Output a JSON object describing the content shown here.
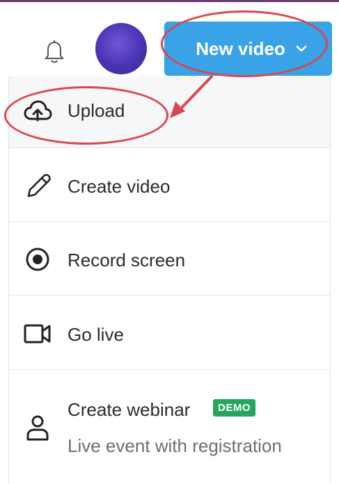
{
  "header": {
    "new_video_label": "New video"
  },
  "menu": {
    "upload_label": "Upload",
    "create_video_label": "Create video",
    "record_screen_label": "Record screen",
    "go_live_label": "Go live",
    "create_webinar_label": "Create webinar",
    "create_webinar_badge": "DEMO",
    "create_webinar_subtitle": "Live event with registration"
  },
  "icons": {
    "notification": "bell-icon",
    "new_video_dropdown": "chevron-down-icon",
    "upload": "cloud-upload-icon",
    "create_video": "pencil-icon",
    "record_screen": "record-icon",
    "go_live": "video-camera-icon",
    "create_webinar": "user-icon"
  },
  "colors": {
    "accent_button": "#3aa2e6",
    "annotation_red": "#d9484e",
    "demo_badge": "#25a55f",
    "top_border": "#6b3a6e"
  }
}
